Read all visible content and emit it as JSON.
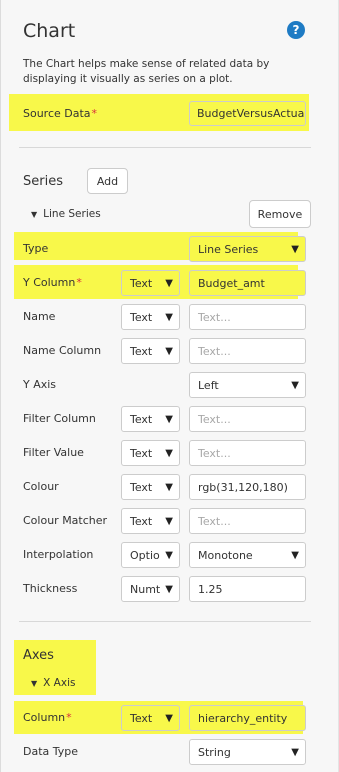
{
  "header": {
    "title": "Chart",
    "help_icon": "?",
    "description": "The Chart helps make sense of related data by displaying it visually as series on a plot."
  },
  "source_data": {
    "label": "Source Data",
    "required_mark": "*",
    "value": "BudgetVersusActual"
  },
  "series": {
    "heading": "Series",
    "add_label": "Add",
    "line_series_toggle": "Line Series",
    "remove_label": "Remove",
    "type": {
      "label": "Type",
      "value": "Line Series"
    },
    "y_column": {
      "label": "Y Column",
      "required_mark": "*",
      "mode": "Text",
      "value": "Budget_amt"
    },
    "name": {
      "label": "Name",
      "mode": "Text",
      "placeholder": "Text..."
    },
    "name_column": {
      "label": "Name Column",
      "mode": "Text",
      "placeholder": "Text..."
    },
    "y_axis": {
      "label": "Y Axis",
      "value": "Left"
    },
    "filter_column": {
      "label": "Filter Column",
      "mode": "Text",
      "placeholder": "Text..."
    },
    "filter_value": {
      "label": "Filter Value",
      "mode": "Text",
      "placeholder": "Text..."
    },
    "colour": {
      "label": "Colour",
      "mode": "Text",
      "value": "rgb(31,120,180)"
    },
    "colour_matcher": {
      "label": "Colour Matcher",
      "mode": "Text",
      "placeholder": "Text..."
    },
    "interpolation": {
      "label": "Interpolation",
      "mode": "Optio",
      "value": "Monotone"
    },
    "thickness": {
      "label": "Thickness",
      "mode": "Numt",
      "value": "1.25"
    }
  },
  "axes": {
    "heading": "Axes",
    "x_axis_toggle": "X Axis",
    "column": {
      "label": "Column",
      "required_mark": "*",
      "mode": "Text",
      "value": "hierarchy_entity"
    },
    "data_type": {
      "label": "Data Type",
      "value": "String"
    }
  },
  "colors": {
    "highlight": "#f8f84a",
    "help": "#1e7bc4",
    "required": "#d9303e"
  }
}
